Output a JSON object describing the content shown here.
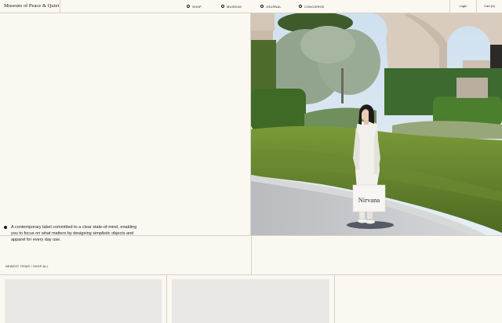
{
  "header": {
    "brand": "Museum of Peace & Quiet",
    "nav": [
      {
        "label": "SHOP",
        "icon": "circle-bullet-icon"
      },
      {
        "label": "MUSEUM",
        "icon": "circle-bullet-icon"
      },
      {
        "label": "JOURNAL",
        "icon": "circle-bullet-icon"
      },
      {
        "label": "CONCIERGE",
        "icon": "circle-bullet-icon"
      }
    ],
    "login": "Login",
    "cart": "Cart (0)"
  },
  "hero": {
    "tagline": "A contemporary label committed to a clear state-of-mind, enabling you to focus on what matters by designing simplistic objects and apparel for every day use.",
    "photo": {
      "tote_text": "Nirvana",
      "colors": {
        "sky": "#cfe0ef",
        "hedge": "#5f7a2d",
        "arch": "#d8cbbd"
      }
    }
  },
  "section": {
    "newest": "NEWEST ITEMS / SHOP ALL"
  },
  "colors": {
    "background": "#fbf8f2",
    "divider": "#d8d3c8",
    "placeholder": "#e9e8e5",
    "text": "#1d1d1b"
  }
}
